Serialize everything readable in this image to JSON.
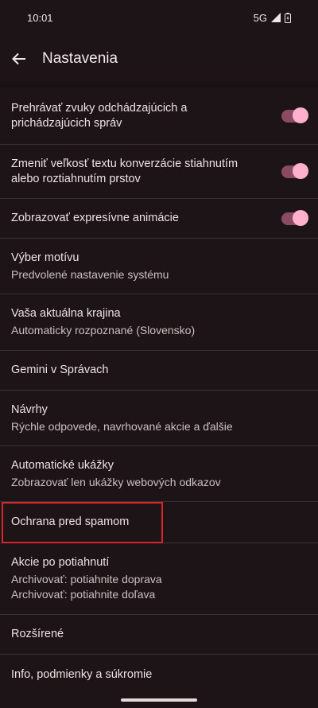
{
  "status_bar": {
    "time": "10:01",
    "network": "5G"
  },
  "header": {
    "title": "Nastavenia"
  },
  "settings": [
    {
      "title": "Prehrávať zvuky odchádzajúcich a prichádzajúcich správ",
      "subtitle": "",
      "toggle": true
    },
    {
      "title": "Zmeniť veľkosť textu konverzácie stiahnutím alebo roztiahnutím prstov",
      "subtitle": "",
      "toggle": true
    },
    {
      "title": "Zobrazovať expresívne animácie",
      "subtitle": "",
      "toggle": true
    },
    {
      "title": "Výber motívu",
      "subtitle": "Predvolené nastavenie systému"
    },
    {
      "title": "Vaša aktuálna krajina",
      "subtitle": "Automaticky rozpoznané (Slovensko)"
    },
    {
      "title": "Gemini v Správach",
      "subtitle": ""
    },
    {
      "title": "Návrhy",
      "subtitle": "Rýchle odpovede, navrhované akcie a ďalšie"
    },
    {
      "title": "Automatické ukážky",
      "subtitle": "Zobrazovať len ukážky webových odkazov"
    },
    {
      "title": "Ochrana pred spamom",
      "subtitle": ""
    },
    {
      "title": "Akcie po potiahnutí",
      "subtitle": "Archivovať: potiahnite doprava",
      "subtitle2": "Archivovať: potiahnite doľava"
    },
    {
      "title": "Rozšírené",
      "subtitle": ""
    },
    {
      "title": "Info, podmienky a súkromie",
      "subtitle": ""
    }
  ],
  "colors": {
    "background": "#1c1416",
    "toggle_track": "#8a4a62",
    "toggle_knob": "#ffb0cc",
    "highlight": "#d3262e"
  }
}
